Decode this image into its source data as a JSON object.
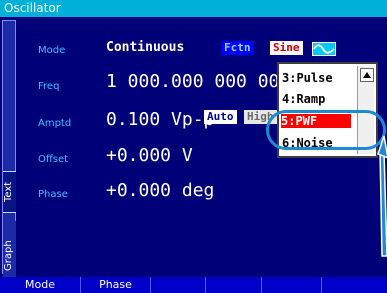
{
  "window": {
    "title": "Oscillator"
  },
  "side_tabs": {
    "text": "Text",
    "graph": "Graph"
  },
  "rows": [
    {
      "label": "Mode",
      "value": "Continuous"
    },
    {
      "label": "Freq",
      "value": "1 000.000 000 00"
    },
    {
      "label": "Amptd",
      "value": "0.100 Vp-p"
    },
    {
      "label": "Offset",
      "value": "+0.000 V"
    },
    {
      "label": "Phase",
      "value": "+0.000 deg"
    }
  ],
  "badges": {
    "fctn": "Fctn",
    "sine": "Sine",
    "auto": "Auto",
    "high": "High"
  },
  "dropdown": {
    "items": [
      "3:Pulse",
      "4:Ramp",
      "5:PWF",
      "6:Noise"
    ],
    "selected_index": 2
  },
  "softkeys": [
    "Mode",
    "Phase",
    "",
    "",
    "",
    ""
  ],
  "colors": {
    "accent_cyan": "#00c9ff",
    "background": "#000079",
    "highlight_red": "#ff0000"
  },
  "icons": {
    "sine": "sine-wave-icon",
    "scroll_up": "chevron-up-icon"
  }
}
